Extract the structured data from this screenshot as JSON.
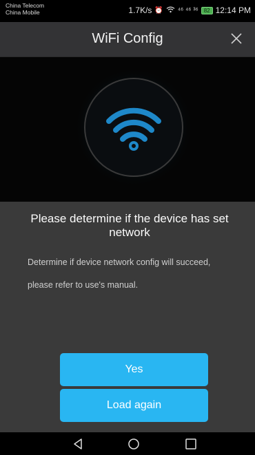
{
  "status_bar": {
    "carrier1": "China Telecom",
    "carrier2": "China Mobile",
    "speed": "1.7K/s",
    "signal_text": "⁴⁶ ⁴⁶ ³⁶",
    "battery": "82",
    "time": "12:14 PM"
  },
  "header": {
    "title": "WiFi Config",
    "close_icon": "close-icon"
  },
  "hero": {
    "icon": "wifi-icon",
    "accent_color": "#1e88c9",
    "ring_color": "#3a3a3a"
  },
  "dialog": {
    "heading": "Please determine if the device has set network",
    "description": "Determine if device network config will succeed, please refer to use's manual.",
    "yes_label": "Yes",
    "load_again_label": "Load again",
    "button_color": "#29b6f2"
  },
  "nav": {
    "back_icon": "back-triangle-icon",
    "home_icon": "home-circle-icon",
    "recents_icon": "recents-square-icon"
  }
}
